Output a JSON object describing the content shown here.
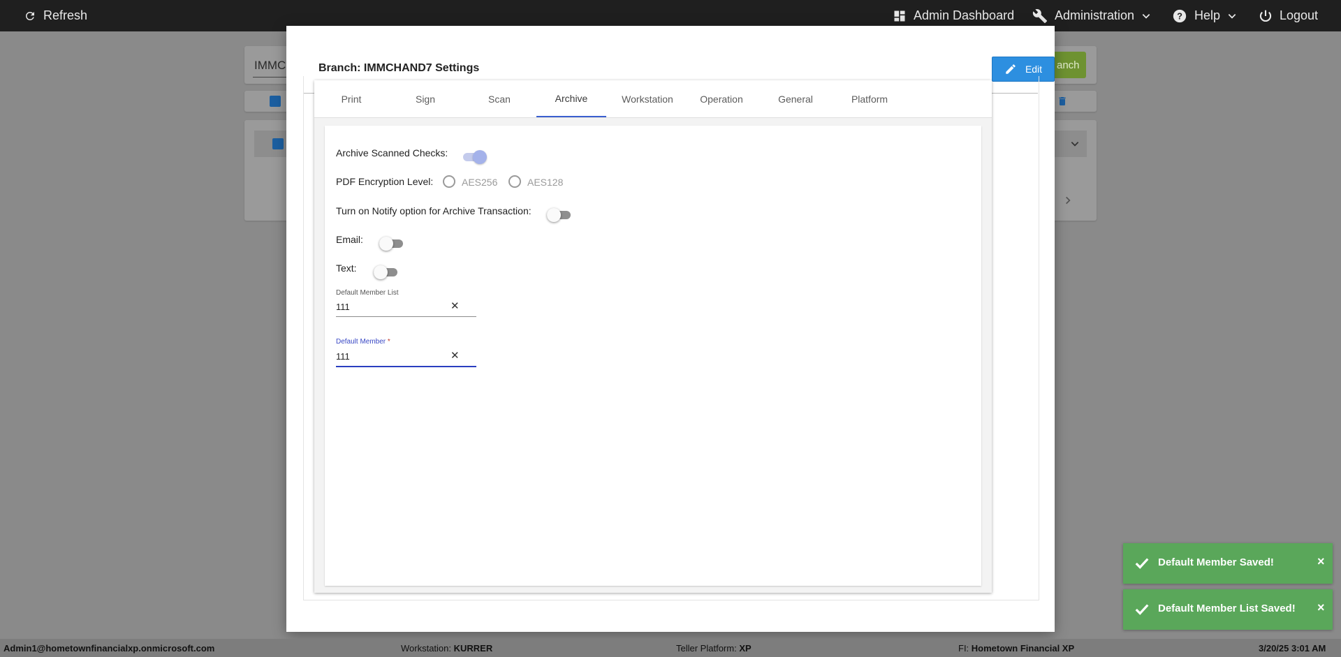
{
  "topbar": {
    "refresh_label": "Refresh",
    "admin_dashboard_label": "Admin Dashboard",
    "administration_label": "Administration",
    "help_label": "Help",
    "logout_label": "Logout"
  },
  "background": {
    "search_value": "IMMC",
    "button_fragment": "anch"
  },
  "modal": {
    "title": "Branch: IMMCHAND7 Settings",
    "edit_label": "Edit",
    "tabs": [
      {
        "label": "Print"
      },
      {
        "label": "Sign"
      },
      {
        "label": "Scan"
      },
      {
        "label": "Archive",
        "active": true
      },
      {
        "label": "Workstation"
      },
      {
        "label": "Operation"
      },
      {
        "label": "General"
      },
      {
        "label": "Platform"
      }
    ],
    "archive": {
      "archive_scanned_label": "Archive Scanned Checks:",
      "archive_scanned_on": true,
      "pdf_encryption_label": "PDF Encryption Level:",
      "pdf_options": [
        "AES256",
        "AES128"
      ],
      "notify_label": "Turn on Notify option for Archive Transaction:",
      "notify_on": false,
      "email_label": "Email:",
      "email_on": false,
      "text_label": "Text:",
      "text_on": false,
      "default_member_list_label": "Default Member List",
      "default_member_list_value": "111",
      "default_member_label": "Default Member",
      "default_member_required": "*",
      "default_member_value": "111"
    }
  },
  "toasts": [
    {
      "message": "Default Member Saved!",
      "close": "×"
    },
    {
      "message": "Default Member List Saved!",
      "close": "×"
    }
  ],
  "statusbar": {
    "user": "Admin1@hometownfinancialxp.onmicrosoft.com",
    "workstation_label": "Workstation: ",
    "workstation_value": "KURRER",
    "teller_platform_label": "Teller Platform: ",
    "teller_platform_value": "XP",
    "fi_label": "FI: ",
    "fi_value": "Hometown Financial XP",
    "datetime": "3/20/25 3:01 AM"
  },
  "colors": {
    "accent_blue": "#2d8fe0",
    "tab_indicator": "#3a5fcf",
    "toast_green": "#5aa75a",
    "topbar": "#1f1f1f"
  },
  "icons": {
    "refresh": "refresh-icon",
    "dashboard": "dashboard-icon",
    "administration": "wrench-icon",
    "help": "help-circle-icon",
    "logout": "power-icon",
    "edit": "pencil-icon",
    "toast": "check-icon"
  }
}
